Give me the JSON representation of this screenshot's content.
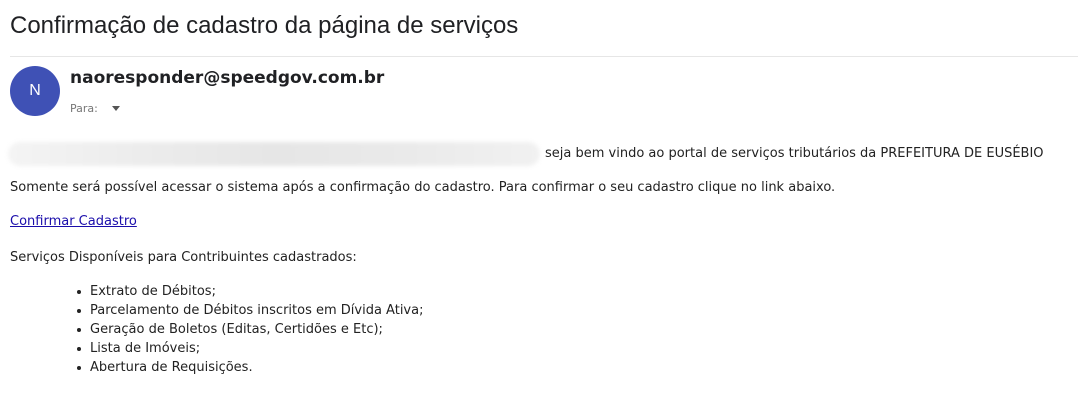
{
  "email": {
    "subject": "Confirmação de cadastro da página de serviços",
    "avatar_initial": "N",
    "sender": "naoresponder@speedgov.com.br",
    "to_label": "Para:",
    "welcome_text": "seja bem vindo ao portal de serviços tributários da PREFEITURA DE EUSÉBIO",
    "notice_text": "Somente será possível acessar o sistema após a confirmação do cadastro. Para confirmar o seu cadastro clique no link abaixo.",
    "confirm_link": "Confirmar Cadastro",
    "services_title": "Serviços Disponíveis para Contribuintes cadastrados:",
    "services": [
      "Extrato de Débitos;",
      "Parcelamento de Débitos inscritos em Dívida Ativa;",
      "Geração de Boletos (Editas, Certidões e Etc);",
      "Lista de Imóveis;",
      "Abertura de Requisições."
    ]
  },
  "colors": {
    "avatar_bg": "#3f51b5",
    "link": "#1a0dab"
  },
  "icons": {
    "recipients_toggle": "chevron-down-icon"
  }
}
